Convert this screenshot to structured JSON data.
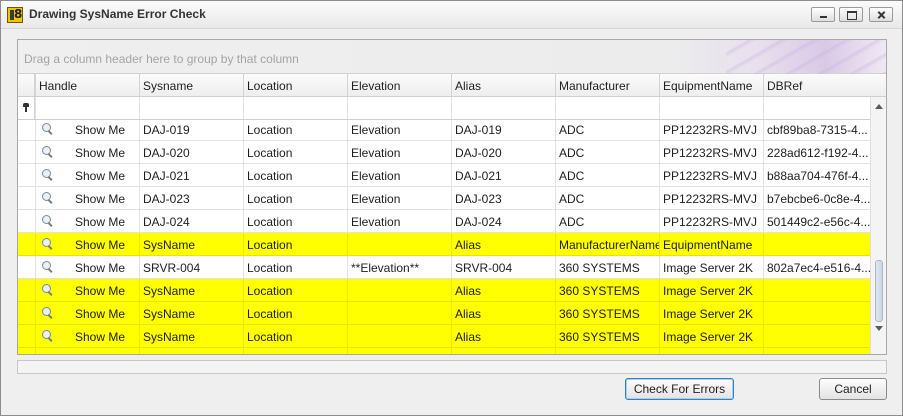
{
  "window": {
    "title": "Drawing SysName Error Check",
    "app_icon_glyph": "8"
  },
  "grid": {
    "group_hint": "Drag a column header here to group by that column",
    "columns": [
      "Handle",
      "Sysname",
      "Location",
      "Elevation",
      "Alias",
      "Manufacturer",
      "EquipmentName",
      "DBRef"
    ],
    "rows": [
      {
        "handle": "Show Me",
        "sysname": "DAJ-019",
        "location": "Location",
        "elevation": "Elevation",
        "alias": "DAJ-019",
        "manufacturer": "ADC",
        "equipment": "PP12232RS-MVJ",
        "dbref": "cbf89ba8-7315-4...",
        "error": false
      },
      {
        "handle": "Show Me",
        "sysname": "DAJ-020",
        "location": "Location",
        "elevation": "Elevation",
        "alias": "DAJ-020",
        "manufacturer": "ADC",
        "equipment": "PP12232RS-MVJ",
        "dbref": "228ad612-f192-4...",
        "error": false
      },
      {
        "handle": "Show Me",
        "sysname": "DAJ-021",
        "location": "Location",
        "elevation": "Elevation",
        "alias": "DAJ-021",
        "manufacturer": "ADC",
        "equipment": "PP12232RS-MVJ",
        "dbref": "b88aa704-476f-4...",
        "error": false
      },
      {
        "handle": "Show Me",
        "sysname": "DAJ-023",
        "location": "Location",
        "elevation": "Elevation",
        "alias": "DAJ-023",
        "manufacturer": "ADC",
        "equipment": "PP12232RS-MVJ",
        "dbref": "b7ebcbe6-0c8e-4...",
        "error": false
      },
      {
        "handle": "Show Me",
        "sysname": "DAJ-024",
        "location": "Location",
        "elevation": "Elevation",
        "alias": "DAJ-024",
        "manufacturer": "ADC",
        "equipment": "PP12232RS-MVJ",
        "dbref": "501449c2-e56c-4...",
        "error": false
      },
      {
        "handle": "Show Me",
        "sysname": "SysName",
        "location": "Location",
        "elevation": "",
        "alias": "Alias",
        "manufacturer": "ManufacturerName",
        "equipment": "EquipmentName",
        "dbref": "",
        "error": true
      },
      {
        "handle": "Show Me",
        "sysname": "SRVR-004",
        "location": "Location",
        "elevation": "**Elevation**",
        "alias": "SRVR-004",
        "manufacturer": "360 SYSTEMS",
        "equipment": "Image Server 2K",
        "dbref": "802a7ec4-e516-4...",
        "error": false
      },
      {
        "handle": "Show Me",
        "sysname": "SysName",
        "location": "Location",
        "elevation": "",
        "alias": "Alias",
        "manufacturer": "360 SYSTEMS",
        "equipment": "Image Server 2K",
        "dbref": "",
        "error": true
      },
      {
        "handle": "Show Me",
        "sysname": "SysName",
        "location": "Location",
        "elevation": "",
        "alias": "Alias",
        "manufacturer": "360 SYSTEMS",
        "equipment": "Image Server 2K",
        "dbref": "",
        "error": true
      },
      {
        "handle": "Show Me",
        "sysname": "SysName",
        "location": "Location",
        "elevation": "",
        "alias": "Alias",
        "manufacturer": "360 SYSTEMS",
        "equipment": "Image Server 2K",
        "dbref": "",
        "error": true
      },
      {
        "handle": "",
        "sysname": "",
        "location": "",
        "elevation": "",
        "alias": "",
        "manufacturer": "",
        "equipment": "",
        "dbref": "",
        "error": true
      }
    ]
  },
  "buttons": {
    "check": "Check For Errors",
    "cancel": "Cancel"
  },
  "colors": {
    "error_row": "#ffff00",
    "focus_border": "#3c7fb1"
  },
  "icons": {
    "row_action": "magnifier-icon",
    "filter": "pin-icon"
  }
}
